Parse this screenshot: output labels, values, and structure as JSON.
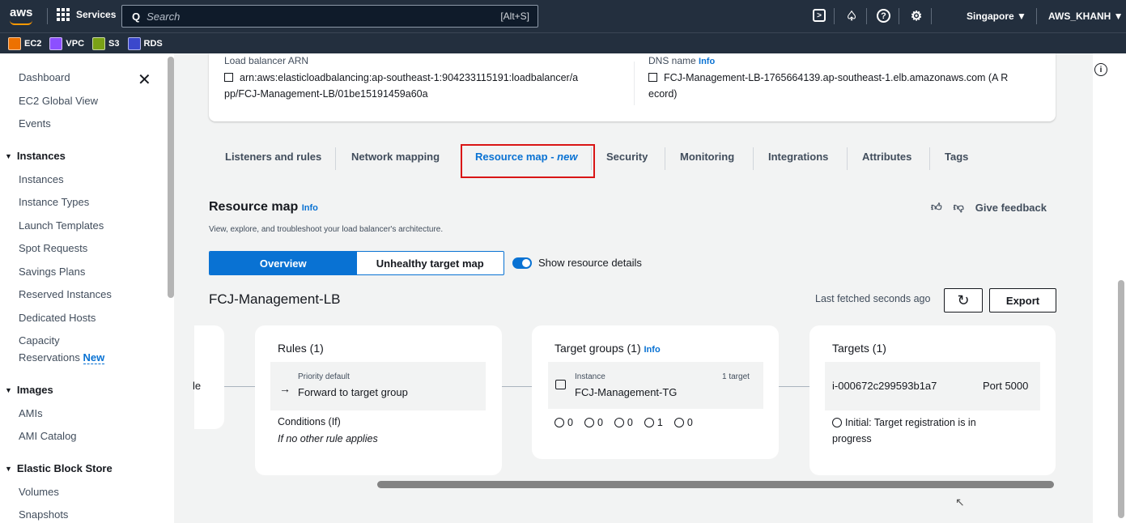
{
  "topbar": {
    "logo": "aws",
    "services": "Services",
    "search_placeholder": "Search",
    "search_shortcut": "[Alt+S]",
    "region": "Singapore ▼",
    "account": "AWS_KHANH ▼"
  },
  "favorites": [
    {
      "label": "EC2",
      "color": "#ed7100"
    },
    {
      "label": "VPC",
      "color": "#8c4fff"
    },
    {
      "label": "S3",
      "color": "#7aa116"
    },
    {
      "label": "RDS",
      "color": "#3b48cc"
    }
  ],
  "sidebar": {
    "items_top": [
      "Dashboard",
      "EC2 Global View",
      "Events"
    ],
    "instances_header": "Instances",
    "instances_items": [
      "Instances",
      "Instance Types",
      "Launch Templates",
      "Spot Requests",
      "Savings Plans",
      "Reserved Instances",
      "Dedicated Hosts",
      "Capacity",
      "Reservations"
    ],
    "new_badge": "New",
    "images_header": "Images",
    "images_items": [
      "AMIs",
      "AMI Catalog"
    ],
    "ebs_header": "Elastic Block Store",
    "ebs_items": [
      "Volumes",
      "Snapshots"
    ]
  },
  "details": {
    "arn_label": "Load balancer ARN",
    "arn_line1": "arn:aws:elasticloadbalancing:ap-southeast-1:904233115191:loadbalancer/a",
    "arn_line2": "pp/FCJ-Management-LB/01be15191459a60a",
    "dns_label": "DNS name",
    "info": "Info",
    "dns_line1": "FCJ-Management-LB-1765664139.ap-southeast-1.elb.amazonaws.com (A R",
    "dns_line2": "ecord)"
  },
  "tabs": {
    "listeners": "Listeners and rules",
    "network": "Network mapping",
    "resource_map": "Resource map - ",
    "resource_map_new": "new",
    "security": "Security",
    "monitoring": "Monitoring",
    "integrations": "Integrations",
    "attributes": "Attributes",
    "tags": "Tags"
  },
  "resource_map": {
    "title": "Resource map",
    "info": "Info",
    "description": "View, explore, and troubleshoot your load balancer's architecture.",
    "feedback": "Give feedback",
    "seg_overview": "Overview",
    "seg_unhealthy": "Unhealthy target map",
    "toggle_label": "Show resource details",
    "lb_name": "FCJ-Management-LB",
    "last_fetched": "Last fetched seconds ago",
    "export": "Export"
  },
  "nodes": {
    "partial_text": "le",
    "rules": {
      "title": "Rules (1)",
      "priority": "Priority default",
      "action": "Forward to target group",
      "conditions_label": "Conditions (If)",
      "conditions_value": "If no other rule applies"
    },
    "target_groups": {
      "title": "Target groups (1)",
      "info": "Info",
      "type": "Instance",
      "count": "1 target",
      "name": "FCJ-Management-TG",
      "counts": [
        "0",
        "0",
        "0",
        "1",
        "0"
      ]
    },
    "targets": {
      "title": "Targets (1)",
      "instance_id": "i-000672c299593b1a7",
      "port": "Port 5000",
      "status_line1": "Initial: Target registration is in",
      "status_line2": "progress"
    }
  }
}
